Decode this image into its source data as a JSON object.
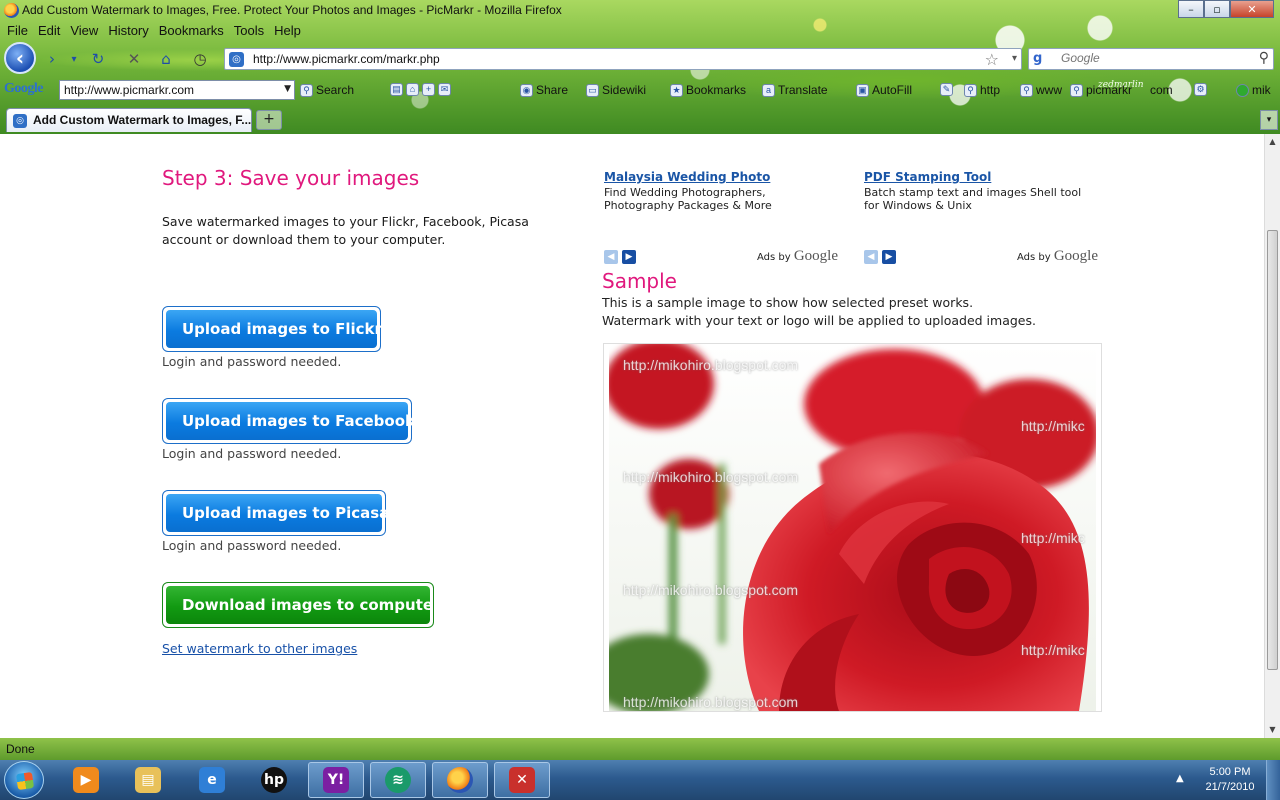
{
  "window": {
    "title": "Add Custom Watermark to Images, Free. Protect Your Photos and Images - PicMarkr - Mozilla Firefox",
    "controls": {
      "minimize": "–",
      "maximize": "▫",
      "close": "✕"
    }
  },
  "menu": [
    "File",
    "Edit",
    "View",
    "History",
    "Bookmarks",
    "Tools",
    "Help"
  ],
  "navigation": {
    "url": "http://www.picmarkr.com/markr.php",
    "search_engine": "Google",
    "search_placeholder": "Google",
    "persona_name": "zedmarlin"
  },
  "google_toolbar": {
    "logo": "Google",
    "query": "http://www.picmarkr.com",
    "items": [
      "Search",
      "Share",
      "Sidewiki",
      "Bookmarks",
      "Translate",
      "AutoFill",
      "http",
      "www",
      "picmarkr",
      "com",
      "mik"
    ]
  },
  "tabs": [
    {
      "label": "Add Custom Watermark to Images, F...",
      "active": true
    }
  ],
  "new_tab_label": "+",
  "page": {
    "step_title": "Step 3: Save your images",
    "step_description": "Save watermarked images to your Flickr, Facebook, Picasa account or download them to your computer.",
    "buttons": [
      {
        "label": "Upload images to Flickr",
        "note": "Login and password needed."
      },
      {
        "label": "Upload images to Facebook",
        "note": "Login and password needed."
      },
      {
        "label": "Upload images to Picasa",
        "note": "Login and password needed."
      },
      {
        "label": "Download images to computer",
        "note": ""
      }
    ],
    "set_watermark_link": "Set watermark to other images",
    "ads": [
      {
        "title": "Malaysia Wedding Photo",
        "text": "Find Wedding Photographers, Photography Packages & More",
        "ads_by": "Ads by",
        "google": "Google"
      },
      {
        "title": "PDF Stamping Tool",
        "text": "Batch stamp text and images Shell tool for Windows & Unix",
        "ads_by": "Ads by",
        "google": "Google"
      }
    ],
    "sample_title": "Sample",
    "sample_line1": "This is a sample image to show how selected preset works.",
    "sample_line2": "Watermark with your text or logo will be applied to uploaded images.",
    "watermark_text": "http://mikohiro.blogspot.com",
    "watermark_partial": "http://mikc"
  },
  "status": {
    "text": "Done"
  },
  "taskbar": {
    "time": "5:00 PM",
    "date": "21/7/2010",
    "apps": [
      "media-player",
      "explorer",
      "internet-explorer",
      "hp",
      "yahoo-messenger",
      "network-app",
      "firefox",
      "pdf-app"
    ]
  },
  "colors": {
    "heading_pink": "#e0187d",
    "button_blue": "#0b7be0",
    "button_green": "#129a12",
    "link_blue": "#1851a8"
  }
}
